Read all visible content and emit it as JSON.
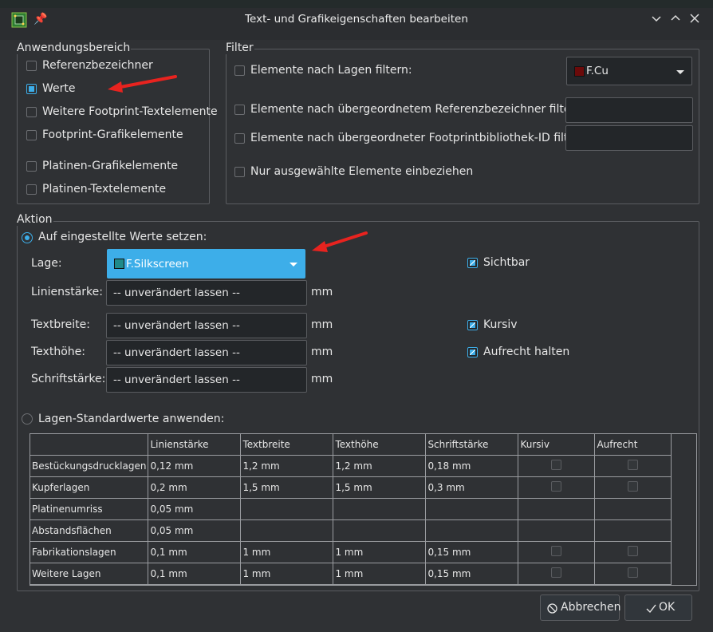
{
  "window": {
    "title": "Text- und Grafikeigenschaften bearbeiten",
    "app_icon": "pcb-icon",
    "pin_icon": "pin-icon",
    "controls": [
      "chevron-down-icon",
      "chevron-up-icon",
      "close-icon"
    ]
  },
  "scope": {
    "label": "Anwendungsbereich",
    "items": [
      {
        "label": "Referenzbezeichner",
        "checked": false
      },
      {
        "label": "Werte",
        "checked": true
      },
      {
        "label": "Weitere Footprint-Textelemente",
        "checked": false
      },
      {
        "label": "Footprint-Grafikelemente",
        "checked": false
      },
      {
        "label": "Platinen-Grafikelemente",
        "checked": false
      },
      {
        "label": "Platinen-Textelemente",
        "checked": false
      }
    ]
  },
  "filter": {
    "label": "Filter",
    "layer_filter": {
      "label": "Elemente nach Lagen filtern:",
      "checked": false,
      "value": "F.Cu",
      "swatch_color": "#6b0a0a"
    },
    "ref_filter": {
      "label": "Elemente nach übergeordnetem Referenzbezeichner filtern:",
      "checked": false,
      "value": ""
    },
    "fpid_filter": {
      "label": "Elemente nach übergeordneter Footprintbibliothek-ID filtern:",
      "checked": false,
      "value": ""
    },
    "selected_only": {
      "label": "Nur ausgewählte Elemente einbeziehen",
      "checked": false
    }
  },
  "action": {
    "label": "Aktion",
    "set_values": {
      "label": "Auf eingestellte Werte setzen:",
      "selected": true
    },
    "layer": {
      "label": "Lage:",
      "value": "F.Silkscreen",
      "swatch_color": "#1f8a8a"
    },
    "line_width": {
      "label": "Linienstärke:",
      "value": "-- unverändert lassen --",
      "unit": "mm"
    },
    "text_width": {
      "label": "Textbreite:",
      "value": "-- unverändert lassen --",
      "unit": "mm"
    },
    "text_height": {
      "label": "Texthöhe:",
      "value": "-- unverändert lassen --",
      "unit": "mm"
    },
    "text_thickness": {
      "label": "Schriftstärke:",
      "value": "-- unverändert lassen --",
      "unit": "mm"
    },
    "visible": {
      "label": "Sichtbar",
      "checked": true
    },
    "italic": {
      "label": "Kursiv",
      "checked": true
    },
    "keep_upright": {
      "label": "Aufrecht halten",
      "checked": true
    },
    "layer_defaults": {
      "label": "Lagen-Standardwerte anwenden:",
      "selected": false
    }
  },
  "table": {
    "headers": [
      "",
      "Linienstärke",
      "Textbreite",
      "Texthöhe",
      "Schriftstärke",
      "Kursiv",
      "Aufrecht"
    ],
    "rows": [
      {
        "layer": "Bestückungsdrucklagen",
        "line": "0,12 mm",
        "tw": "1,2 mm",
        "th": "1,2 mm",
        "thick": "0,18 mm",
        "has_checks": true
      },
      {
        "layer": "Kupferlagen",
        "line": "0,2 mm",
        "tw": "1,5 mm",
        "th": "1,5 mm",
        "thick": "0,3 mm",
        "has_checks": true
      },
      {
        "layer": "Platinenumriss",
        "line": "0,05 mm",
        "tw": "",
        "th": "",
        "thick": "",
        "has_checks": false
      },
      {
        "layer": "Abstandsflächen",
        "line": "0,05 mm",
        "tw": "",
        "th": "",
        "thick": "",
        "has_checks": false
      },
      {
        "layer": "Fabrikationslagen",
        "line": "0,1 mm",
        "tw": "1 mm",
        "th": "1 mm",
        "thick": "0,15 mm",
        "has_checks": true
      },
      {
        "layer": "Weitere Lagen",
        "line": "0,1 mm",
        "tw": "1 mm",
        "th": "1 mm",
        "thick": "0,15 mm",
        "has_checks": true
      }
    ]
  },
  "buttons": {
    "cancel": {
      "label": "Abbrechen",
      "icon": "cancel-icon"
    },
    "ok": {
      "label": "OK",
      "icon": "check-icon"
    }
  },
  "colors": {
    "accent": "#3daee9",
    "background": "#2f3134",
    "field": "#232629",
    "annotation_arrow": "#e8231f"
  }
}
